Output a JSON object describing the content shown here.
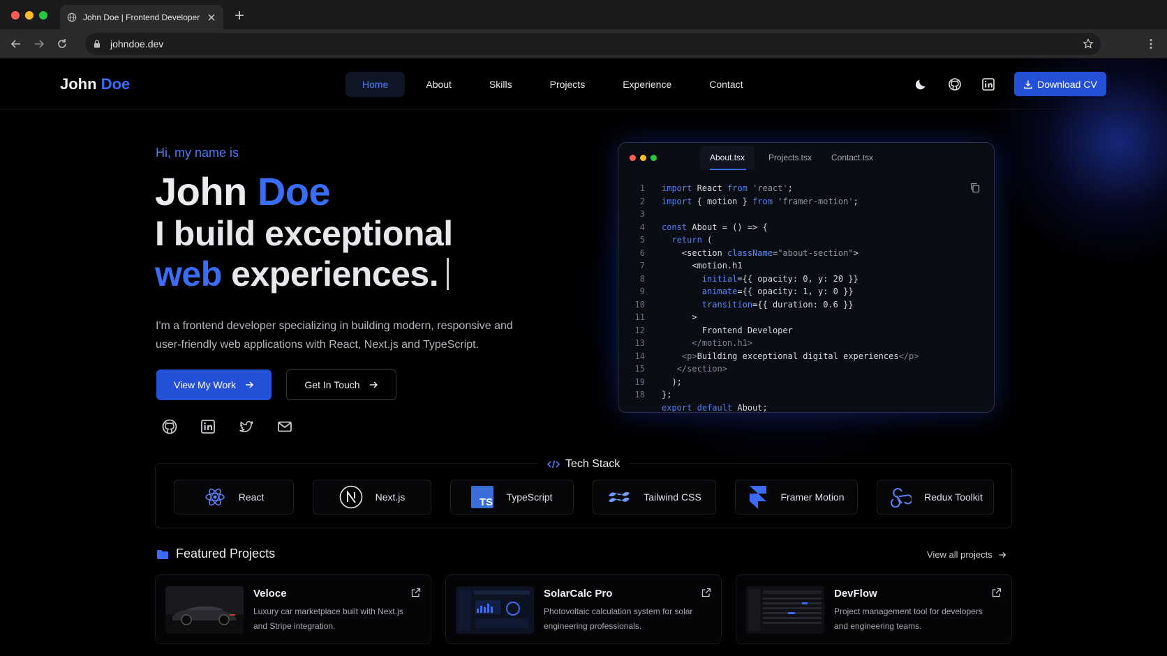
{
  "browser": {
    "tab_title": "John Doe | Frontend Developer",
    "url": "johndoe.dev"
  },
  "nav": {
    "logo_first": "John",
    "logo_last": "Doe",
    "items": [
      "Home",
      "About",
      "Skills",
      "Projects",
      "Experience",
      "Contact"
    ],
    "active": "Home",
    "download_label": "Download CV"
  },
  "hero": {
    "greeting": "Hi, my name is",
    "name_first": "John",
    "name_last": "Doe",
    "line1": "I build exceptional",
    "line2_accent": "web",
    "line2_rest": "experiences.",
    "description": "I'm a frontend developer specializing in building modern, responsive and user-friendly web applications with React, Next.js and TypeScript.",
    "primary_button": "View My Work",
    "secondary_button": "Get In Touch"
  },
  "code_window": {
    "tabs": [
      "About.tsx",
      "Projects.tsx",
      "Contact.tsx"
    ],
    "active_tab": "About.tsx",
    "line_numbers": [
      "1",
      "2",
      "3",
      "4",
      "5",
      "6",
      "7",
      "8",
      "9",
      "10",
      "11",
      "12",
      "13",
      "14",
      "15",
      "19",
      "18"
    ],
    "lines": [
      "import React from 'react';",
      "import { motion } from 'framer-motion';",
      "",
      "const About = () => {",
      "  return (",
      "    <section className=\"about-section\">",
      "      <motion.h1",
      "        initial={{ opacity: 0, y: 20 }}",
      "        animate={{ opacity: 1, y: 0 }}",
      "        transition={{ duration: 0.6 }}",
      "      >",
      "        Frontend Developer",
      "      </motion.h1>",
      "    <p>Building exceptional digital experiences</p>",
      "   </section>",
      "  );",
      "};",
      "export default About;"
    ]
  },
  "tech_stack": {
    "title": "Tech Stack",
    "items": [
      "React",
      "Next.js",
      "TypeScript",
      "Tailwind CSS",
      "Framer Motion",
      "Redux Toolkit"
    ]
  },
  "projects": {
    "title": "Featured Projects",
    "view_all": "View all projects",
    "items": [
      {
        "name": "Veloce",
        "description": "Luxury car marketplace built with Next.js and Stripe integration."
      },
      {
        "name": "SolarCalc Pro",
        "description": "Photovoltaic calculation system for solar engineering professionals."
      },
      {
        "name": "DevFlow",
        "description": "Project management tool for developers and engineering teams."
      }
    ]
  },
  "colors": {
    "accent": "#3b6cf6",
    "button": "#2450d8",
    "background": "#000000"
  }
}
